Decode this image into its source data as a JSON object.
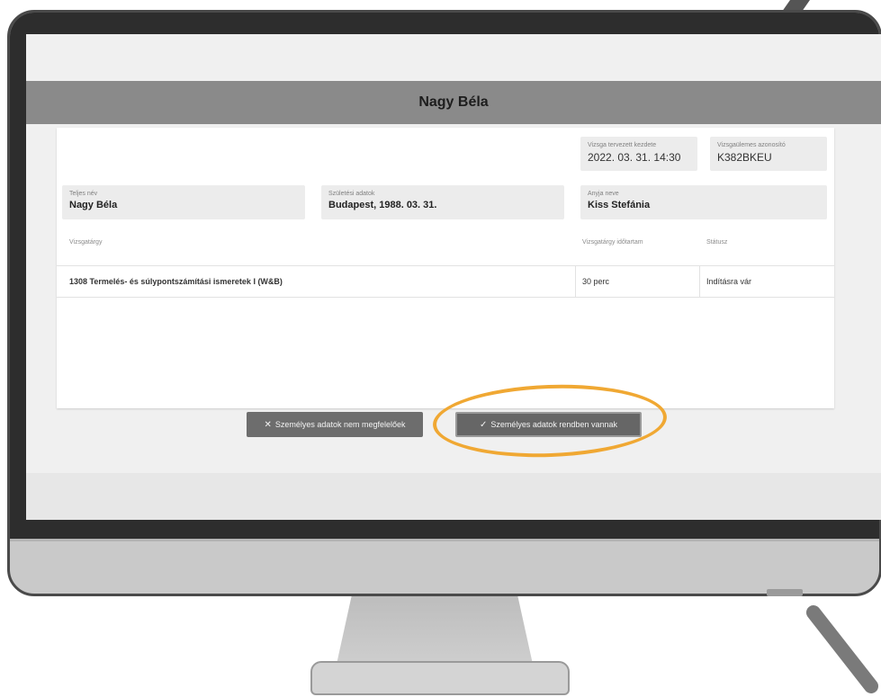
{
  "window": {
    "title": "Nagy Béla"
  },
  "exam_info": {
    "planned_start_label": "Vizsga tervezett kezdete",
    "planned_start_value": "2022. 03. 31. 14:30",
    "session_id_label": "Vizsgaülemes azonosító",
    "session_id_value": "K382BKEU"
  },
  "person": {
    "full_name_label": "Teljes név",
    "full_name_value": "Nagy Béla",
    "birth_label": "Születési adatok",
    "birth_value": "Budapest,  1988. 03. 31.",
    "mother_label": "Anyja neve",
    "mother_value": "Kiss Stefánia"
  },
  "table": {
    "headers": [
      "Vizsgatárgy",
      "Vizsgatárgy időtartam",
      "Státusz"
    ],
    "rows": [
      {
        "subject": "1308 Termelés- és súlypontszámítási ismeretek I (W&B)",
        "duration": "30 perc",
        "status": "Indításra vár"
      }
    ]
  },
  "actions": {
    "reject_label": "Személyes adatok nem megfelelőek",
    "confirm_label": "Személyes adatok rendben vannak"
  },
  "colors": {
    "highlight": "#f0a833",
    "title_bar": "#8a8a8a"
  },
  "icons": {
    "reject": "close-icon",
    "confirm": "check-icon"
  }
}
